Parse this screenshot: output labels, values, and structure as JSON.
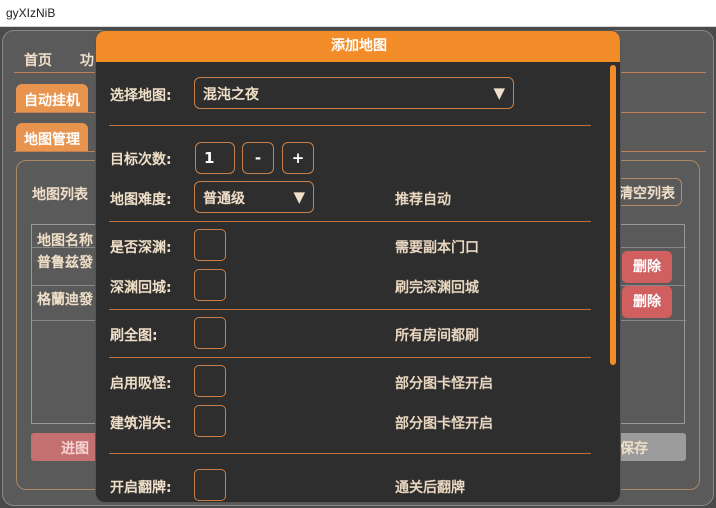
{
  "window": {
    "title": "gyXIzNiB"
  },
  "nav": {
    "tabs": [
      "首页",
      "功"
    ]
  },
  "main": {
    "tab_auto": "自动挂机",
    "tab_map_mgmt": "地图管理",
    "list_title": "地图列表",
    "clear_button": "清空列表",
    "table_header": "地图名称",
    "rows": [
      "普鲁兹發",
      "格蘭迪發"
    ],
    "delete_label": "删除",
    "enter_button": "进图",
    "save_button": "保存"
  },
  "modal": {
    "title": "添加地图",
    "select_map": {
      "label": "选择地图:",
      "value": "混沌之夜"
    },
    "target_count": {
      "label": "目标次数:",
      "value": "1",
      "minus": "-",
      "plus": "+"
    },
    "difficulty": {
      "label": "地图难度:",
      "value": "普通级",
      "hint": "推荐自动"
    },
    "abyss": {
      "label": "是否深渊:",
      "hint": "需要副本门口"
    },
    "abyss_return": {
      "label": "深渊回城:",
      "hint": "刷完深渊回城"
    },
    "full_map": {
      "label": "刷全图:",
      "hint": "所有房间都刷"
    },
    "suction": {
      "label": "启用吸怪:",
      "hint": "部分图卡怪开启"
    },
    "building": {
      "label": "建筑消失:",
      "hint": "部分图卡怪开启"
    },
    "flip_card": {
      "label": "开启翻牌:",
      "hint": "通关后翻牌"
    }
  }
}
